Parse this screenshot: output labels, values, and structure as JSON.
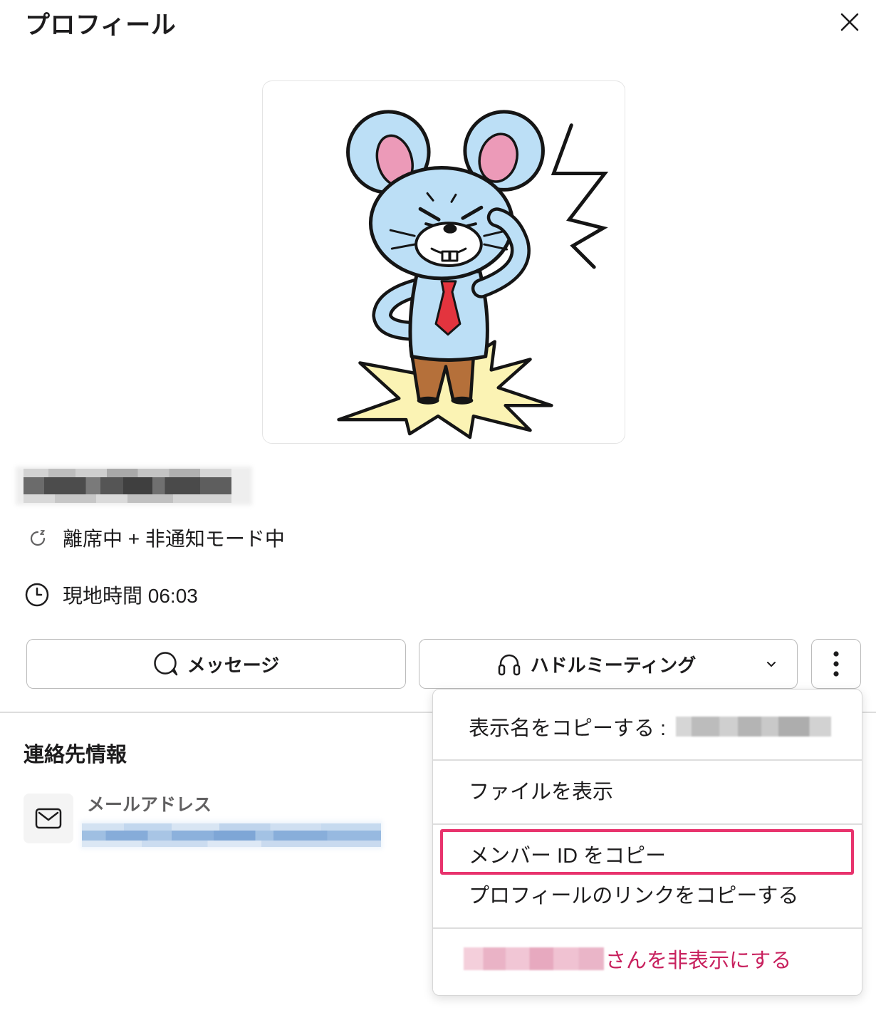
{
  "panel": {
    "title": "プロフィール",
    "close_icon": "close-icon"
  },
  "status": {
    "icon": "away-snooze-icon",
    "text": "離席中 + 非通知モード中"
  },
  "local_time": {
    "icon": "clock-icon",
    "text": "現地時間 06:03"
  },
  "actions": {
    "message": {
      "label": "メッセージ",
      "icon": "message-bubble-icon"
    },
    "huddle": {
      "label": "ハドルミーティング",
      "icon": "headphones-icon",
      "dropdown_icon": "chevron-down-icon"
    },
    "more": {
      "icon": "more-vertical-icon"
    }
  },
  "contact": {
    "heading": "連絡先情報",
    "email": {
      "label": "メールアドレス",
      "icon": "envelope-icon"
    }
  },
  "menu": {
    "items": [
      {
        "label": "表示名をコピーする :"
      },
      {
        "label": "ファイルを表示"
      },
      {
        "label": "メンバー ID をコピー",
        "highlighted": true
      },
      {
        "label": "プロフィールのリンクをコピーする"
      },
      {
        "label": "さんを非表示にする"
      }
    ]
  },
  "colors": {
    "text": "#1d1c1d",
    "muted": "#616061",
    "border": "#bbbbbb",
    "danger": "#c8215e",
    "highlight": "#e8336d",
    "link": "#1264a3"
  }
}
